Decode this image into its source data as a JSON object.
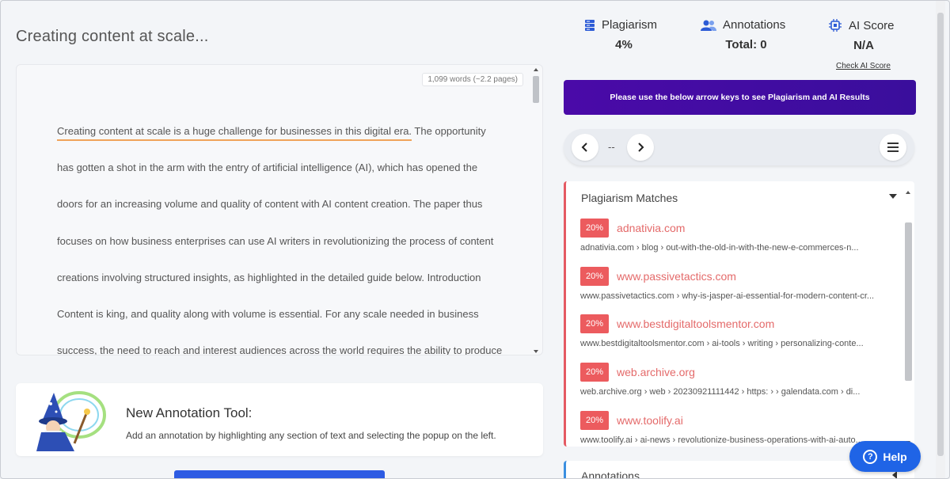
{
  "document": {
    "title": "Creating content at scale...",
    "word_count": "1,099 words (~2.2 pages)",
    "highlighted": "Creating content at scale is a huge challenge for businesses in this digital era.",
    "line1_rest": " The opportunity",
    "lines": [
      "has gotten a shot in the arm with the entry of artificial intelligence (AI), which has opened the",
      "doors for an increasing volume and quality of content with AI content creation. The paper thus",
      "focuses on how business enterprises can use AI writers in revolutionizing the process of content",
      "creations involving structured insights, as highlighted in the detailed guide below. Introduction",
      "Content is king, and quality along with volume is essential. For any scale needed in business",
      "success, the need to reach and interest audiences across the world requires the ability to produce"
    ]
  },
  "annotation_tool": {
    "title": "New Annotation Tool:",
    "description": "Add an annotation by highlighting any section of text and selecting the popup on the left."
  },
  "stats": {
    "plagiarism": {
      "label": "Plagiarism",
      "value": "4%",
      "icon": "server-stack-icon"
    },
    "annotations": {
      "label": "Annotations",
      "value": "Total: 0",
      "icon": "users-icon"
    },
    "ai_score": {
      "label": "AI Score",
      "value": "N/A",
      "icon": "chip-icon",
      "link": "Check AI Score"
    }
  },
  "banner": {
    "text": "Please use the below arrow keys to see Plagiarism and AI Results"
  },
  "nav": {
    "position": "--"
  },
  "matches": {
    "title": "Plagiarism Matches",
    "items": [
      {
        "percent": "20%",
        "domain": "adnativia.com",
        "path": "adnativia.com › blog › out-with-the-old-in-with-the-new-e-commerces-n..."
      },
      {
        "percent": "20%",
        "domain": "www.passivetactics.com",
        "path": "www.passivetactics.com › why-is-jasper-ai-essential-for-modern-content-cr..."
      },
      {
        "percent": "20%",
        "domain": "www.bestdigitaltoolsmentor.com",
        "path": "www.bestdigitaltoolsmentor.com › ai-tools › writing › personalizing-conte..."
      },
      {
        "percent": "20%",
        "domain": "web.archive.org",
        "path": "web.archive.org › web › 20230921111442 › https: › › galendata.com › di..."
      },
      {
        "percent": "20%",
        "domain": "www.toolify.ai",
        "path": "www.toolify.ai › ai-news › revolutionize-business-operations-with-ai-auto..."
      }
    ]
  },
  "annotations_panel": {
    "title": "Annotations"
  },
  "help": {
    "label": "Help"
  },
  "colors": {
    "banner": "#4a0aa8",
    "match_badge": "#ec5b5e",
    "match_domain": "#e46a6a",
    "help_button": "#1f64e6",
    "highlight_underline": "#f0a35a"
  }
}
